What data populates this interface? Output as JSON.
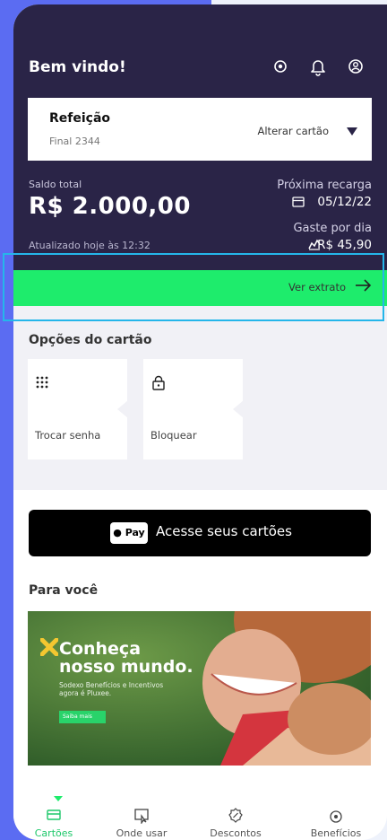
{
  "header": {
    "welcome": "Bem vindo!",
    "icons": [
      "eye-icon",
      "bell-icon",
      "profile-icon"
    ]
  },
  "card": {
    "name": "Refeição",
    "final": "Final 2344",
    "change_label": "Alterar cartão"
  },
  "balance": {
    "label": "Saldo total",
    "value": "R$ 2.000,00",
    "updated": "Atualizado hoje às 12:32"
  },
  "recharge": {
    "label": "Próxima recarga",
    "date": "05/12/22"
  },
  "spend": {
    "label": "Gaste por dia",
    "value": "R$ 45,90"
  },
  "statement": {
    "label": "Ver extrato"
  },
  "options": {
    "title": "Opções do cartão",
    "items": [
      {
        "label": "Trocar senha",
        "icon": "keypad-icon"
      },
      {
        "label": "Bloquear",
        "icon": "lock-icon"
      }
    ]
  },
  "applepay": {
    "badge": "Pay",
    "label": "Acesse seus cartões"
  },
  "for_you": {
    "title": "Para você",
    "banner": {
      "line1": "Conheça",
      "line2": "nosso mundo.",
      "sub1": "Sodexo Benefícios e Incentivos",
      "sub2": "agora é Pluxee.",
      "cta": "Saiba mais"
    }
  },
  "nav": {
    "items": [
      {
        "label": "Cartões",
        "active": true
      },
      {
        "label": "Onde usar",
        "active": false
      },
      {
        "label": "Descontos",
        "active": false
      },
      {
        "label": "Benefícios",
        "active": false
      }
    ]
  },
  "colors": {
    "header_bg": "#2a2447",
    "accent_green": "#1eec6c",
    "highlight_border": "#25b6ea",
    "page_bg_left": "#5b6cf2"
  }
}
